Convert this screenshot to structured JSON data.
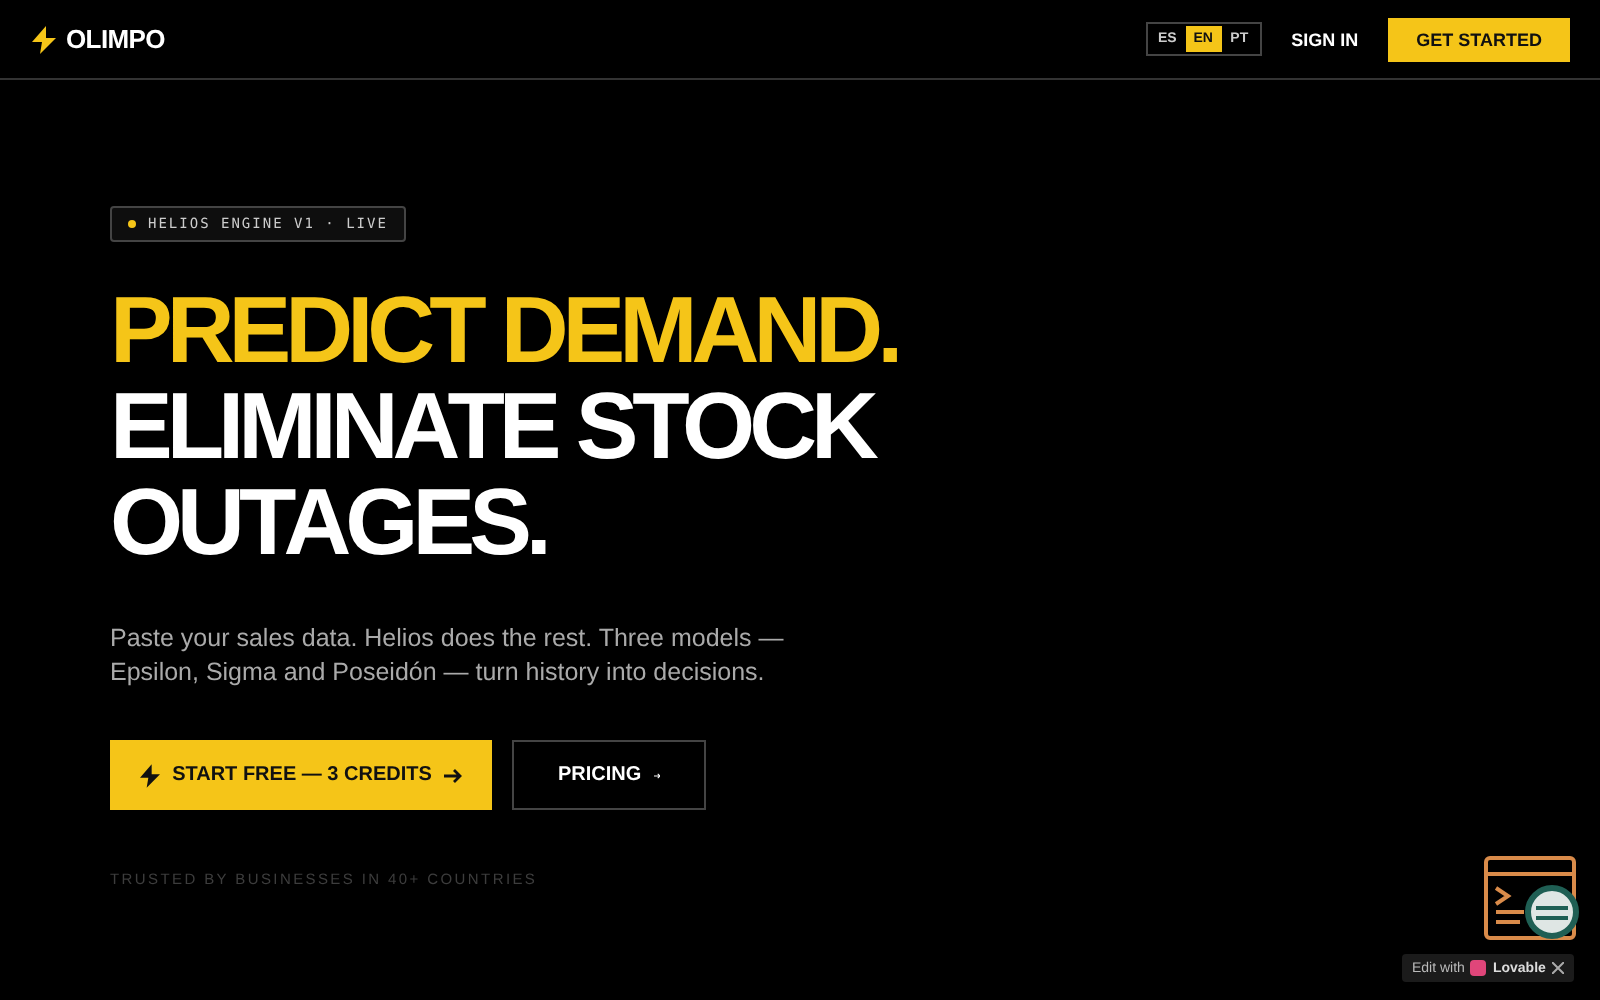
{
  "nav": {
    "logo": "OLIMPO",
    "languages": [
      {
        "label": "ES",
        "selected": false
      },
      {
        "label": "EN",
        "selected": true
      },
      {
        "label": "PT",
        "selected": false
      }
    ],
    "sign_in": "SIGN IN",
    "cta": "GET STARTED"
  },
  "hero": {
    "badge": "HELIOS ENGINE V1 · LIVE",
    "headline": [
      {
        "text": "PREDICT DEMAND.",
        "highlighted": true
      },
      {
        "text": "ELIMINATE STOCK",
        "highlighted": false
      },
      {
        "text": "OUTAGES.",
        "highlighted": false
      }
    ],
    "description": "Paste your sales data. Helios does the rest. Three models — Epsilon, Sigma and Poseidón — turn history into decisions.",
    "primary_button": "START FREE — 3 CREDITS",
    "secondary_button": "PRICING",
    "trust": "TRUSTED BY BUSINESSES IN 40+ COUNTRIES"
  },
  "edit_badge": {
    "prefix": "Edit with",
    "brand": "Lovable"
  }
}
